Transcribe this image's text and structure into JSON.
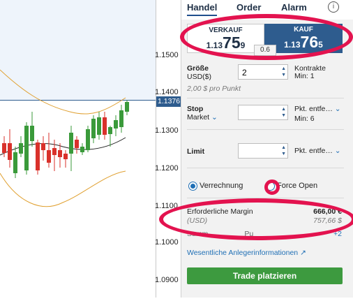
{
  "chart": {
    "y_axis_labels": [
      "1.1500",
      "1.1400",
      "1.1300",
      "1.1200",
      "1.1100",
      "1.1000",
      "1.0900"
    ],
    "current_price_tag": "1.1376"
  },
  "panel": {
    "tabs": [
      "Handel",
      "Order",
      "Alarm"
    ],
    "sell": {
      "label": "VERKAUF",
      "price_prefix": "1.13",
      "price_big": "75",
      "price_suffix": "9"
    },
    "buy": {
      "label": "KAUF",
      "price_prefix": "1.13",
      "price_big": "76",
      "price_suffix": "5"
    },
    "spread": "0.6",
    "size": {
      "label": "Größe",
      "unit": "USD($)",
      "value": "2",
      "hint": "2,00 $ pro Punkt",
      "right_label": "Kontrakte",
      "right_min": "Min: 1"
    },
    "stop": {
      "label": "Stop",
      "type": "Market",
      "right_label": "Pkt. entfe…",
      "right_min": "Min: 6"
    },
    "limit": {
      "label": "Limit",
      "right_label": "Pkt. entfe…"
    },
    "radio": {
      "option1": "Verrechnung",
      "option2": "Force Open"
    },
    "margin": {
      "label": "Erforderliche Margin",
      "label_sub": "(USD)",
      "value": "666,00 €",
      "value_sub": "757,66 $"
    },
    "summary_partial": "Summ",
    "summary_partial_suffix": "Pu",
    "summary_value": "+2",
    "link": "Wesentliche Anlegerinformationen",
    "place_button": "Trade platzieren"
  },
  "colors": {
    "accent": "#2e5c8e",
    "bull": "#3a9a3a",
    "bear": "#d9312b",
    "highlight": "#e3134f",
    "band": "#e0a030"
  }
}
